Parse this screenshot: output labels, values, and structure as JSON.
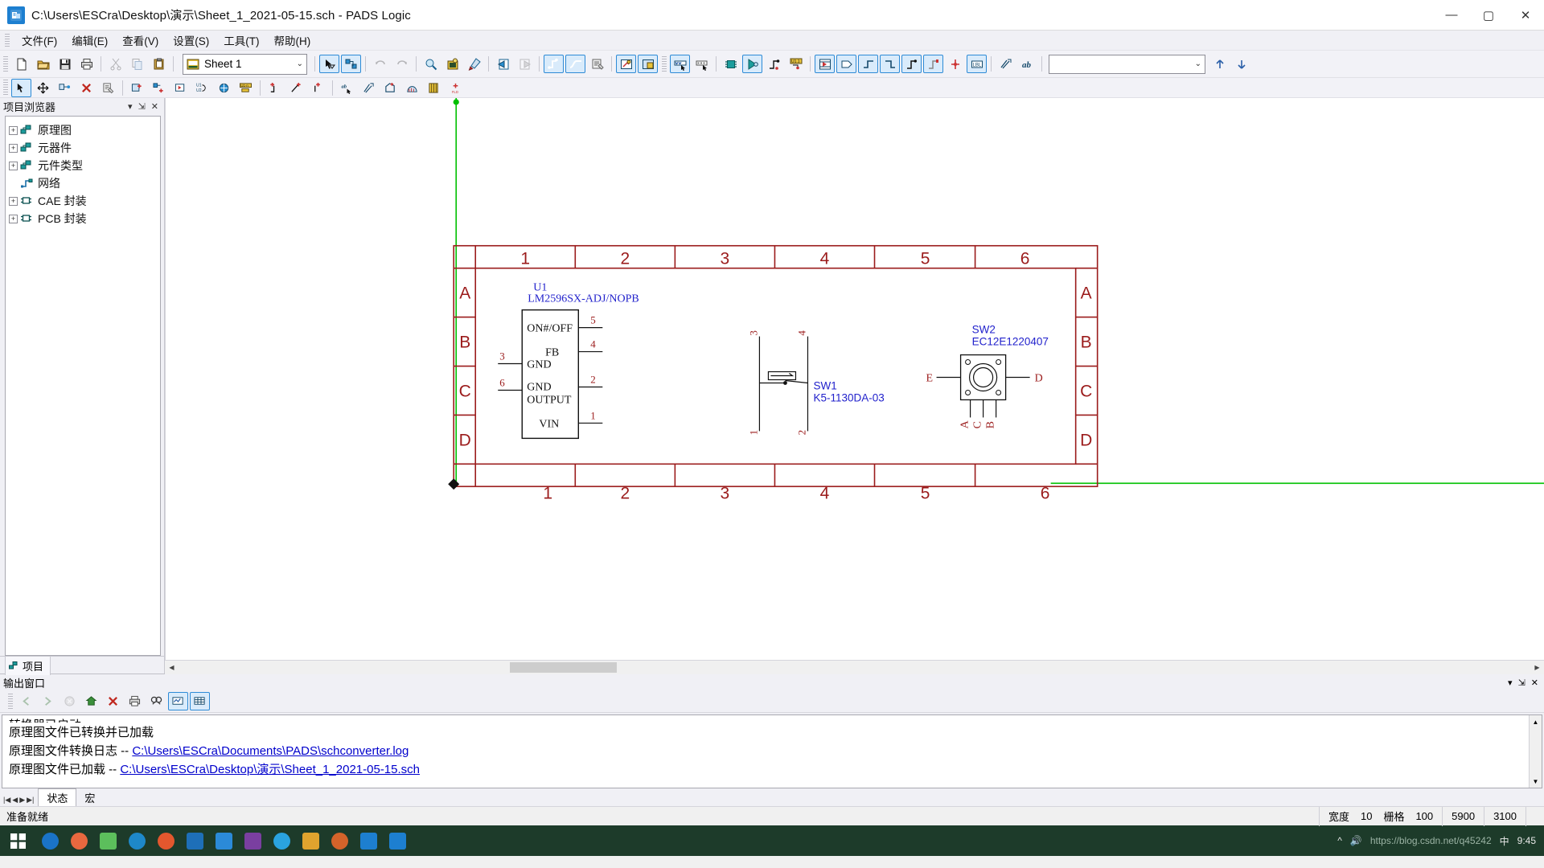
{
  "window": {
    "title": "C:\\Users\\ESCra\\Desktop\\演示\\Sheet_1_2021-05-15.sch - PADS Logic",
    "app_icon": "pads-logic-icon",
    "minimize": "—",
    "maximize": "▢",
    "close": "✕"
  },
  "menu": [
    {
      "label": "文件(F)",
      "name": "menu-file"
    },
    {
      "label": "编辑(E)",
      "name": "menu-edit"
    },
    {
      "label": "查看(V)",
      "name": "menu-view"
    },
    {
      "label": "设置(S)",
      "name": "menu-setup"
    },
    {
      "label": "工具(T)",
      "name": "menu-tools"
    },
    {
      "label": "帮助(H)",
      "name": "menu-help"
    }
  ],
  "toolbar": {
    "sheet_selector": {
      "value": "Sheet 1",
      "chevron": "⌄",
      "icon": "sheet-icon"
    },
    "field_combo": {
      "value": "",
      "chevron": "⌄",
      "placeholder": ""
    },
    "nav_up": "↑",
    "nav_down": "↓"
  },
  "browser": {
    "title": "项目浏览器",
    "menu_glyph": "▾",
    "pin_glyph": "⇲",
    "close_glyph": "✕",
    "items": [
      {
        "label": "原理图",
        "expand": "+",
        "icon": "schematic-icon",
        "name": "tree-item-schematic"
      },
      {
        "label": "元器件",
        "expand": "+",
        "icon": "parts-icon",
        "name": "tree-item-parts"
      },
      {
        "label": "元件类型",
        "expand": "+",
        "icon": "parttype-icon",
        "name": "tree-item-parttypes"
      },
      {
        "label": "网络",
        "expand": "",
        "icon": "net-icon",
        "name": "tree-item-nets"
      },
      {
        "label": "CAE 封装",
        "expand": "+",
        "icon": "cae-icon",
        "name": "tree-item-cae"
      },
      {
        "label": "PCB 封装",
        "expand": "+",
        "icon": "pcb-icon",
        "name": "tree-item-pcb"
      }
    ],
    "tab": {
      "label": "项目",
      "icon": "project-icon"
    }
  },
  "schematic": {
    "border_color": "#9b1b1b",
    "symbol_color": "#000000",
    "ref_color": "#2222cc",
    "pin_color": "#9b1b1b",
    "wire_color": "#00b200",
    "zone_cols_top": [
      "1",
      "2",
      "3",
      "4",
      "5",
      "6"
    ],
    "zone_cols_bottom": [
      "1",
      "2",
      "3",
      "4",
      "5",
      "6"
    ],
    "zone_rows_left": [
      "A",
      "B",
      "C",
      "D"
    ],
    "zone_rows_right": [
      "A",
      "B",
      "C",
      "D"
    ],
    "components": [
      {
        "ref": "U1",
        "part": "LM2596SX-ADJ/NOPB",
        "name": "component-u1",
        "pin_labels": [
          "ON#/OFF",
          "FB",
          "GND",
          "GND",
          "OUTPUT",
          "VIN"
        ],
        "pin_numbers_left": [
          "3",
          "6"
        ],
        "pin_numbers_right": [
          "5",
          "4",
          "2",
          "1"
        ]
      },
      {
        "ref": "SW1",
        "part": "K5-1130DA-03",
        "name": "component-sw1",
        "pin_numbers": [
          "3",
          "4",
          "1",
          "2"
        ]
      },
      {
        "ref": "SW2",
        "part": "EC12E1220407",
        "name": "component-sw2",
        "pin_labels_side": [
          "E",
          "D"
        ],
        "pin_labels_bottom": [
          "A",
          "C",
          "B"
        ]
      }
    ]
  },
  "output": {
    "title": "输出窗口",
    "menu_glyph": "▾",
    "pin_glyph": "⇲",
    "close_glyph": "✕",
    "lines": [
      {
        "text": "转换器已启动",
        "link": "",
        "clipped": true
      },
      {
        "text": "原理图文件已转换并已加载",
        "link": ""
      },
      {
        "text": "原理图文件转换日志  -- ",
        "link": "C:\\Users\\ESCra\\Documents\\PADS\\schconverter.log"
      },
      {
        "text": "原理图文件已加载  -- ",
        "link": "C:\\Users\\ESCra\\Desktop\\演示\\Sheet_1_2021-05-15.sch"
      }
    ],
    "tabs": [
      {
        "label": "状态",
        "active": true,
        "name": "output-tab-status"
      },
      {
        "label": "宏",
        "active": false,
        "name": "output-tab-macro"
      }
    ]
  },
  "status": {
    "message": "准备就绪",
    "width_label": "宽度",
    "width_value": "10",
    "grid_label": "栅格",
    "grid_value": "100",
    "coord_x": "5900",
    "coord_y": "3100"
  },
  "taskbar": {
    "start": "⊞",
    "watermark": "https://blog.csdn.net/q45242",
    "time": "9:45",
    "apps": [
      {
        "name": "taskbar-app-search",
        "color": "#1a73c7"
      },
      {
        "name": "taskbar-app-firefox",
        "color": "#e8683f"
      },
      {
        "name": "taskbar-app-notes",
        "color": "#5cbf5c"
      },
      {
        "name": "taskbar-app-edge",
        "color": "#1e88c9"
      },
      {
        "name": "taskbar-app-music",
        "color": "#e3572e"
      },
      {
        "name": "taskbar-app-xmind",
        "color": "#1e6fb8"
      },
      {
        "name": "taskbar-app-store",
        "color": "#2b8ad8"
      },
      {
        "name": "taskbar-app-onenote",
        "color": "#7a3fa0"
      },
      {
        "name": "taskbar-app-skype",
        "color": "#2aa3e0"
      },
      {
        "name": "taskbar-app-folder",
        "color": "#e0a32e"
      },
      {
        "name": "taskbar-app-paint",
        "color": "#d4632a"
      },
      {
        "name": "taskbar-app-pads1",
        "color": "#1d7fd0"
      },
      {
        "name": "taskbar-app-pads2",
        "color": "#1d7fd0"
      }
    ],
    "tray": [
      "^",
      "🔊",
      "中"
    ]
  }
}
